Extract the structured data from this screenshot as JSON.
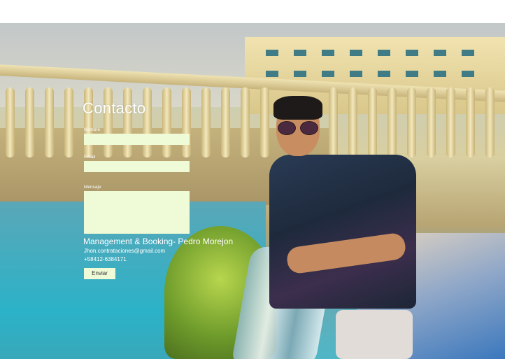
{
  "contact": {
    "title": "Contacto",
    "fields": {
      "name_label": "Nombre",
      "name_value": "",
      "email_label": "Email",
      "email_value": "",
      "message_label": "Mensaje",
      "message_value": ""
    },
    "management": "Management & Booking- Pedro Morejon",
    "email": "Jhon.contrataciones@gmail.com",
    "phone": "+58412-6384171",
    "send_label": "Enviar"
  },
  "colors": {
    "field_bg": "#effbd6",
    "text": "#ffffff"
  }
}
